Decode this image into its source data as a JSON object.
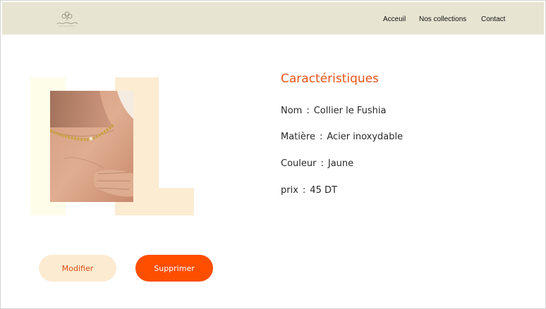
{
  "nav": {
    "logo_icon": "jewelry-brand-logo",
    "links": [
      "Acceuil",
      "Nos collections",
      "Contact"
    ]
  },
  "product": {
    "image_icon": "necklace-photo",
    "section_title": "Caractéristiques",
    "separator": ":",
    "fields": [
      {
        "label": "Nom",
        "value": "Collier le Fushia"
      },
      {
        "label": "Matière",
        "value": "Acier inoxydable"
      },
      {
        "label": "Couleur",
        "value": "Jaune"
      },
      {
        "label": "prix",
        "value": "45 DT"
      }
    ]
  },
  "actions": {
    "edit_label": "Modifier",
    "delete_label": "Supprimer"
  },
  "colors": {
    "navbar_bg": "#e7e5d2",
    "accent": "#e4541c",
    "delete_button": "#fe4e00",
    "edit_button": "#fcebd1",
    "deco_cream": "#fdfdea",
    "deco_peach": "#fcecd2"
  }
}
